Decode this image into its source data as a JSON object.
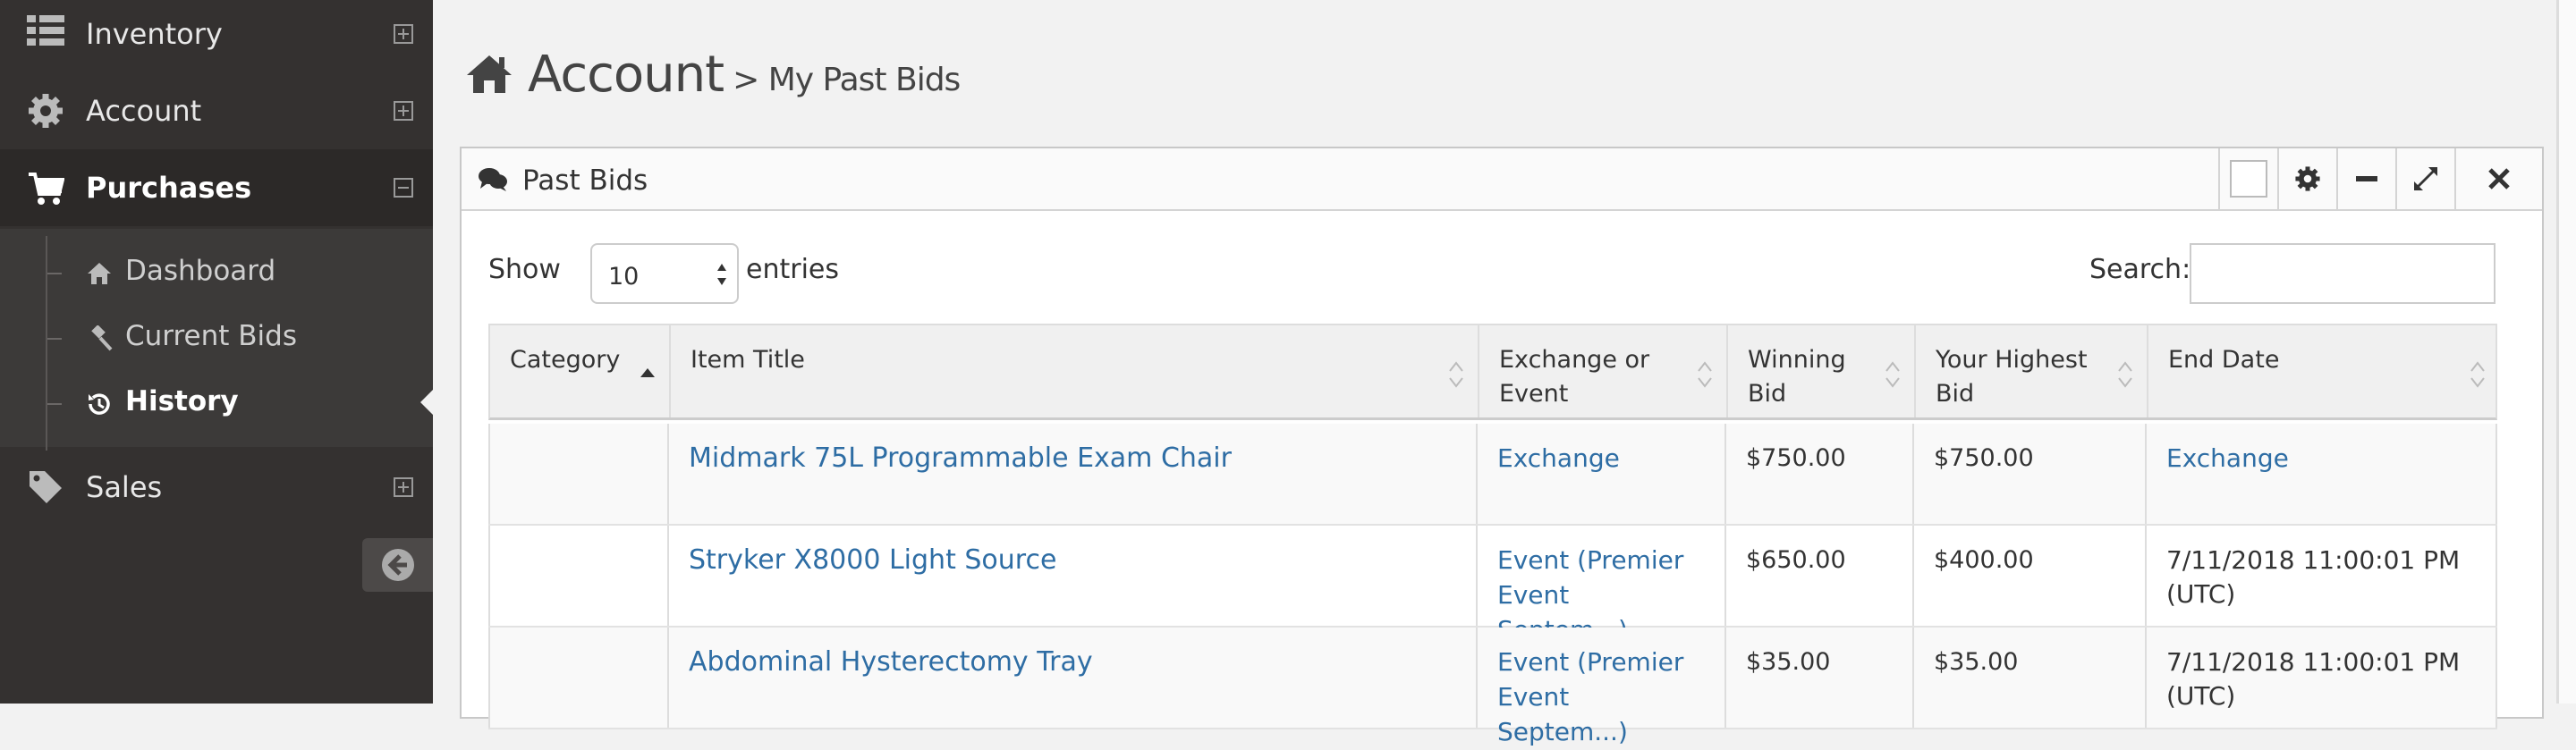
{
  "sidebar": {
    "items": [
      {
        "label": "Inventory",
        "icon": "list-icon"
      },
      {
        "label": "Account",
        "icon": "gear-icon"
      },
      {
        "label": "Purchases",
        "icon": "cart-icon"
      },
      {
        "label": "Sales",
        "icon": "tag-icon"
      }
    ],
    "submenu": [
      {
        "label": "Dashboard",
        "icon": "home-icon"
      },
      {
        "label": "Current Bids",
        "icon": "gavel-icon"
      },
      {
        "label": "History",
        "icon": "history-icon"
      }
    ],
    "active_item": "History"
  },
  "header": {
    "title": "Account",
    "subtitle": "> My Past Bids"
  },
  "widget": {
    "title": "Past Bids",
    "show_label": "Show",
    "page_length": "10",
    "entries_label": "entries",
    "search_label": "Search:",
    "search_value": ""
  },
  "table": {
    "columns": [
      {
        "label": "Category"
      },
      {
        "label": "Item Title"
      },
      {
        "label": "Exchange or Event"
      },
      {
        "label": "Winning Bid"
      },
      {
        "label": "Your Highest Bid"
      },
      {
        "label": "End Date"
      }
    ],
    "sorted_column": "Category",
    "rows": [
      {
        "category": "",
        "title": "Midmark 75L Programmable Exam Chair",
        "exchange": "Exchange",
        "winning": "$750.00",
        "highest": "$750.00",
        "end": "Exchange"
      },
      {
        "category": "",
        "title": "Stryker X8000 Light Source",
        "exchange": "Event (Premier Event Septem...)",
        "winning": "$650.00",
        "highest": "$400.00",
        "end": "7/11/2018 11:00:01 PM (UTC)"
      },
      {
        "category": "",
        "title": "Abdominal Hysterectomy Tray",
        "exchange": "Event (Premier Event Septem...)",
        "winning": "$35.00",
        "highest": "$35.00",
        "end": "7/11/2018 11:00:01 PM (UTC)"
      }
    ]
  },
  "colors": {
    "sidebar_bg": "#343130",
    "link": "#2e6da4",
    "page_bg": "#f2f2f2"
  }
}
